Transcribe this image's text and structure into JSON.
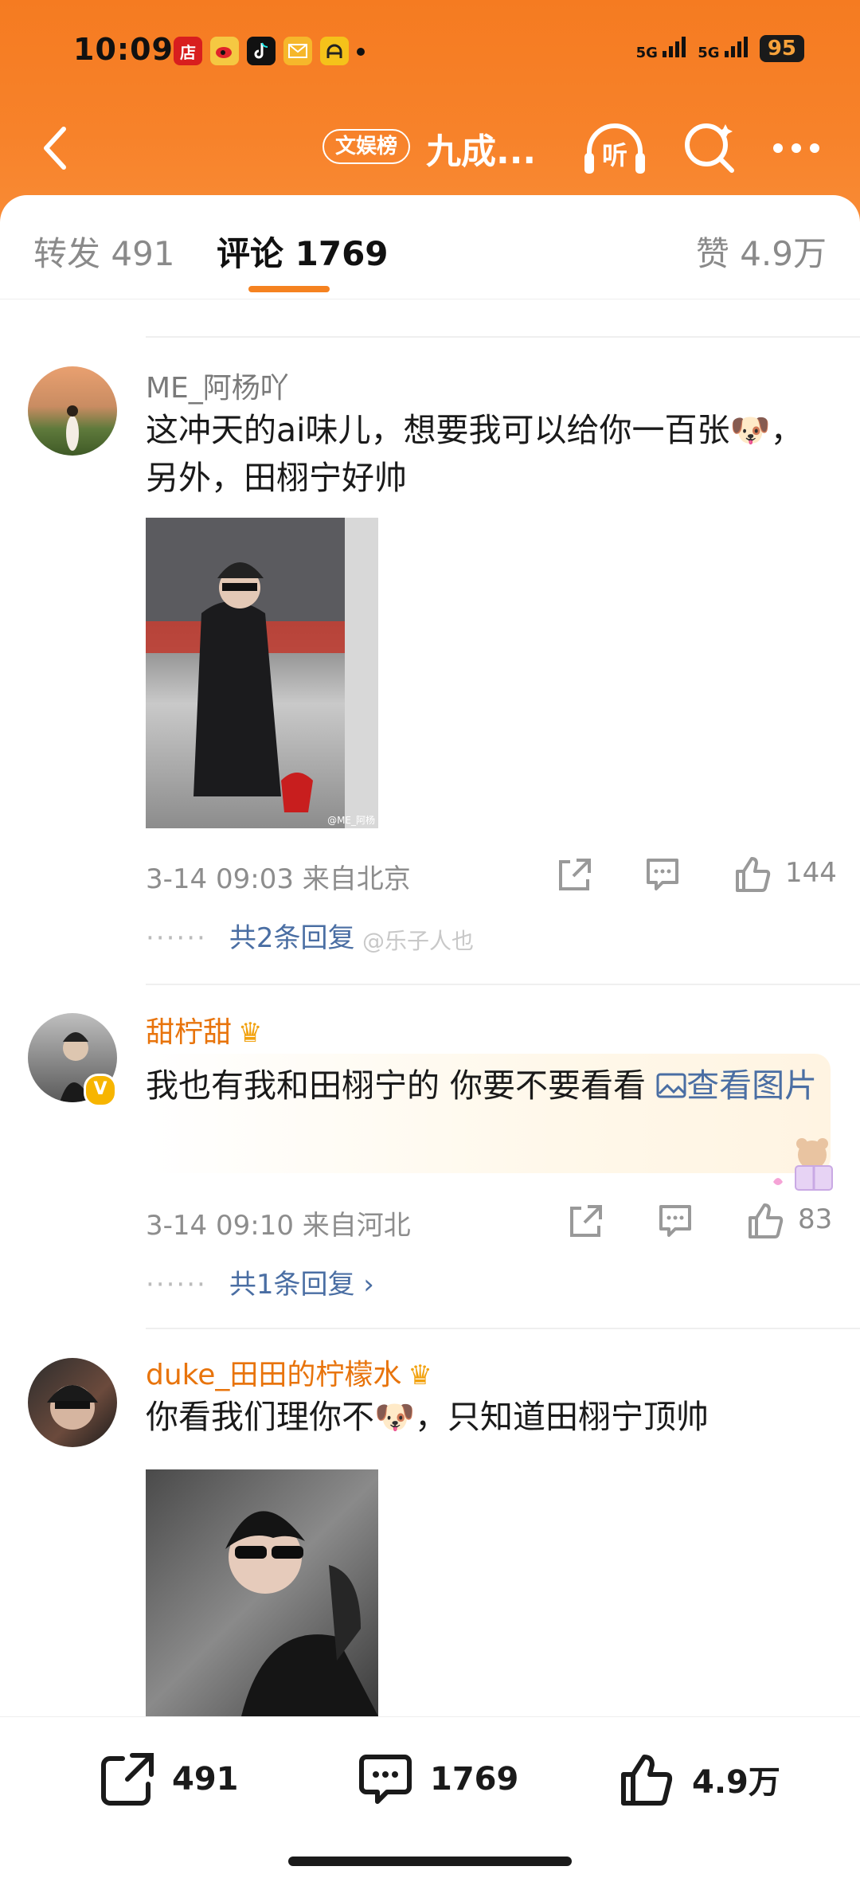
{
  "status_bar": {
    "time": "10:09",
    "battery": "95",
    "signal1": "5G",
    "signal2": "5G"
  },
  "nav": {
    "tag": "文娱榜",
    "title": "九成...",
    "listen_label": "听"
  },
  "tabs": {
    "repost": "转发 491",
    "comment": "评论 1769",
    "likes": "赞 4.9万"
  },
  "comments": [
    {
      "user": "ME_阿杨吖",
      "text": "这冲天的ai味儿，想要我可以给你一百张🐶，另外，田栩宁好帅",
      "meta": "3-14 09:03 来自北京",
      "likes": "144",
      "replies": "共2条回复",
      "image_caption": "@ME_阿杨"
    },
    {
      "user": "甜柠甜",
      "text": "我也有我和田栩宁的 你要不要看看 ",
      "link": "查看图片",
      "meta": "3-14 09:10 来自河北",
      "likes": "83",
      "replies": "共1条回复 ›"
    },
    {
      "user": "duke_田田的柠檬水",
      "text": "你看我们理你不🐶，只知道田栩宁顶帅"
    }
  ],
  "watermark": "@乐子人也",
  "bottom_bar": {
    "repost": "491",
    "comment": "1769",
    "like": "4.9万"
  },
  "colors": {
    "brand_orange": "#f57b21",
    "link_blue": "#4a6ea3"
  }
}
